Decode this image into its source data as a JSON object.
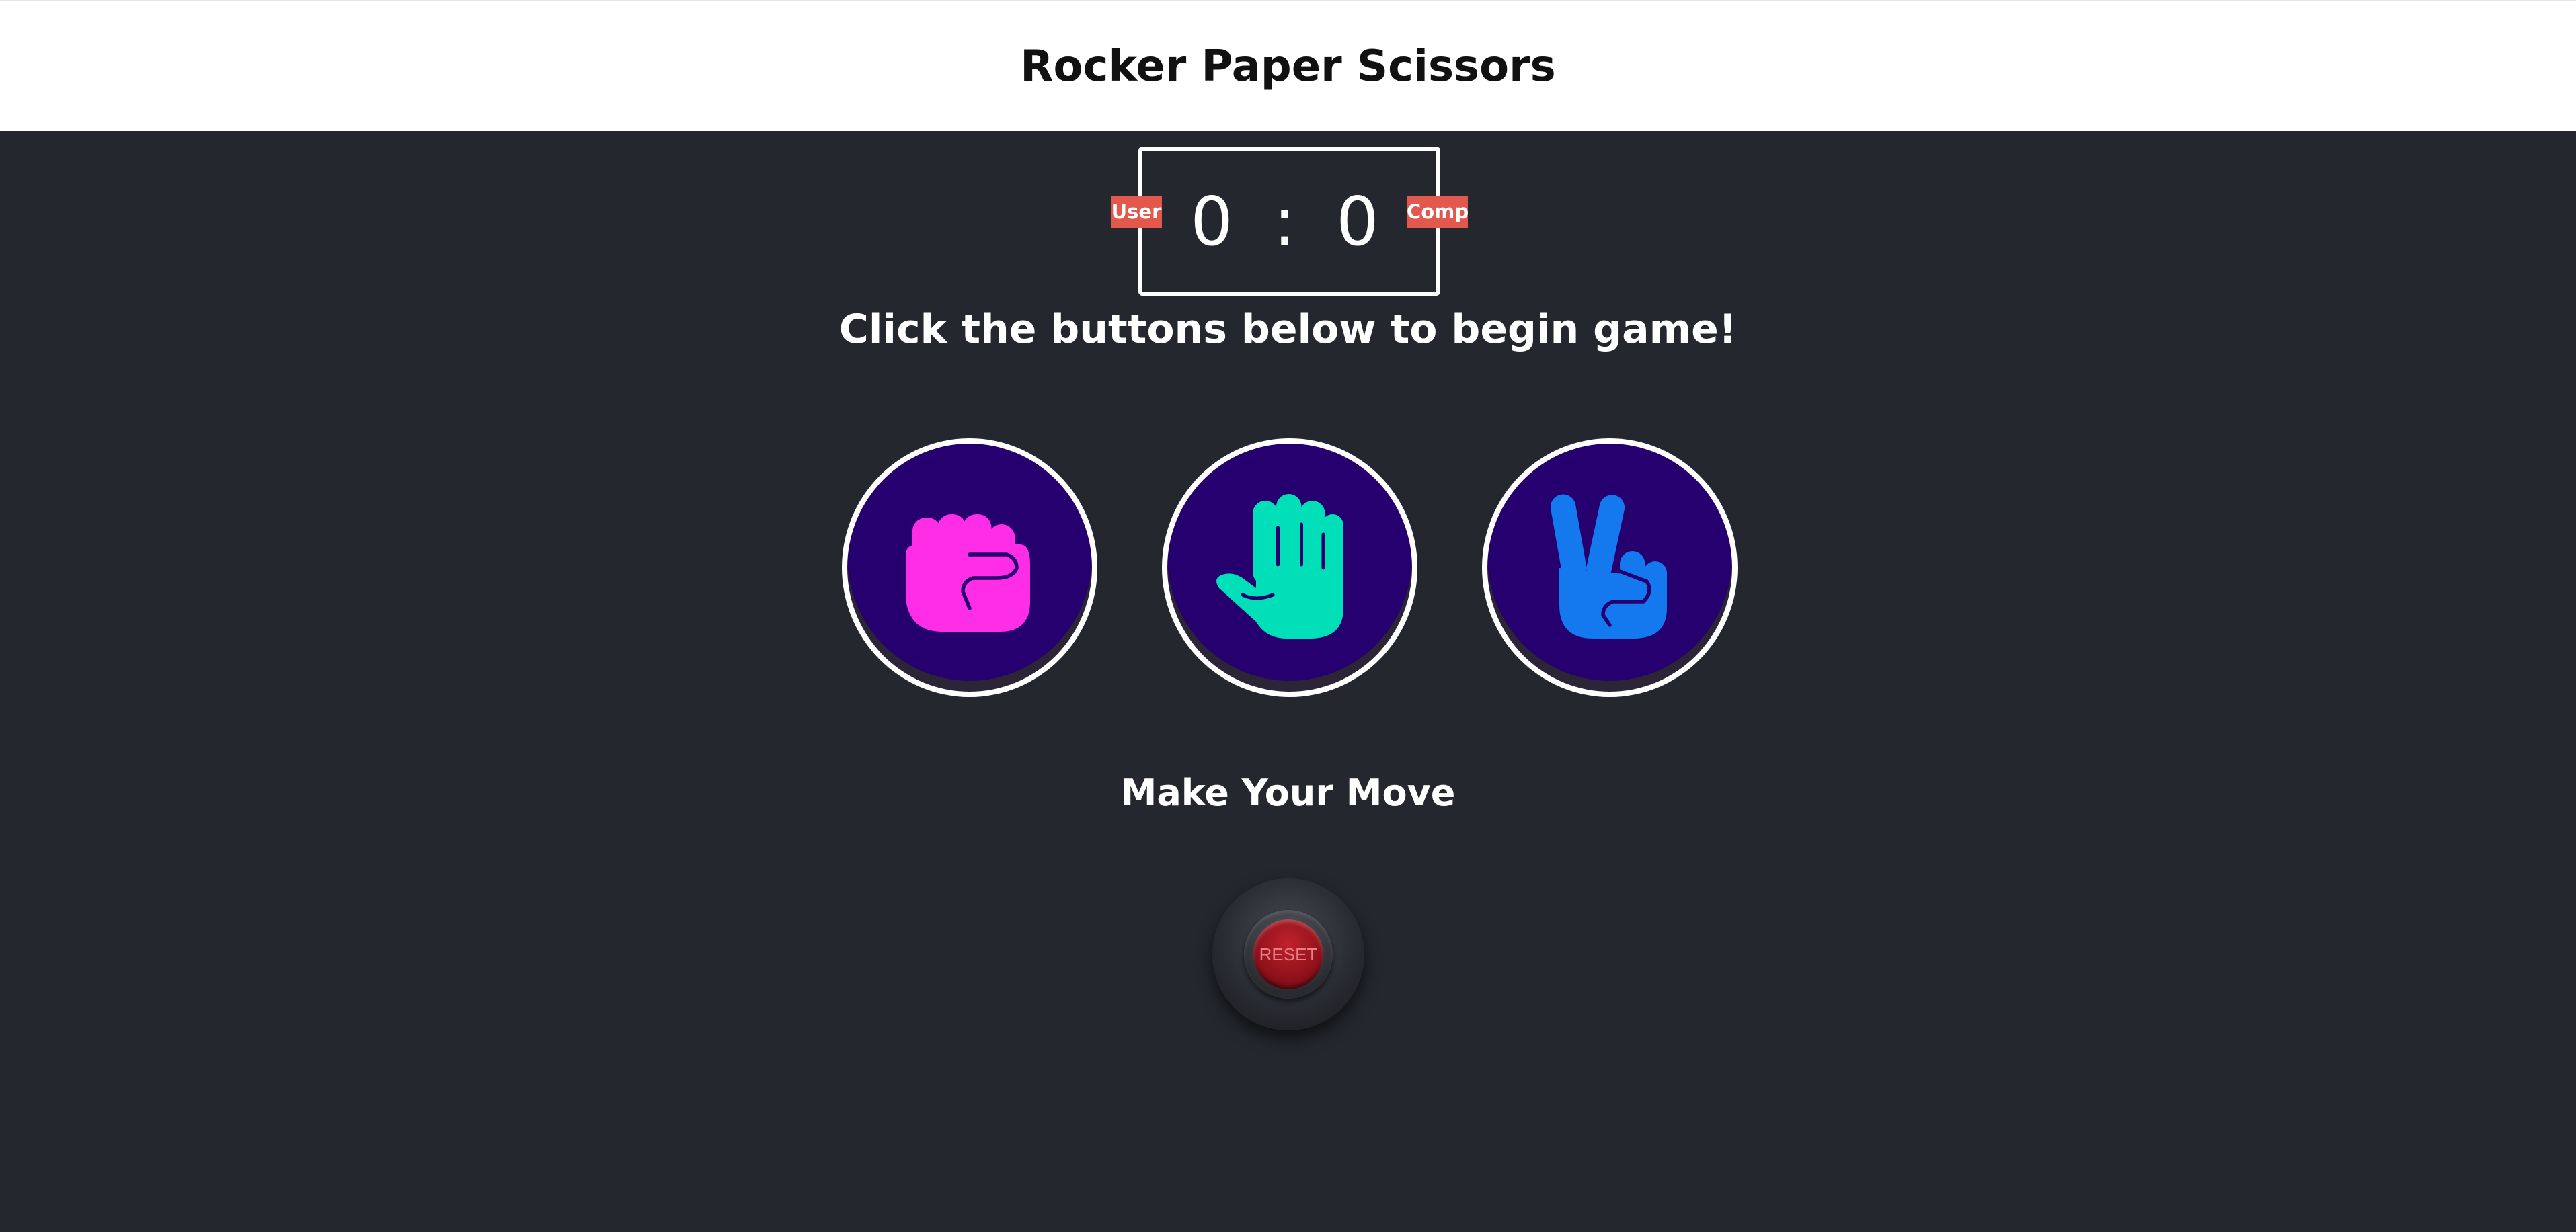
{
  "header": {
    "title": "Rocker Paper Scissors"
  },
  "scoreboard": {
    "user_label": "User",
    "comp_label": "Comp",
    "score_display": "0 : 0",
    "user_score": 0,
    "comp_score": 0
  },
  "message": "Click the buttons below to begin game!",
  "choices": [
    {
      "name": "rock",
      "icon": "fist-icon",
      "color": "#ff2de6"
    },
    {
      "name": "paper",
      "icon": "open-hand-icon",
      "color": "#00dfb8"
    },
    {
      "name": "scissors",
      "icon": "peace-hand-icon",
      "color": "#1478ee"
    }
  ],
  "prompt": "Make Your Move",
  "reset": {
    "label": "RESET"
  },
  "colors": {
    "background": "#24272e",
    "choice_background": "#25006e",
    "badge": "#e2584d"
  }
}
